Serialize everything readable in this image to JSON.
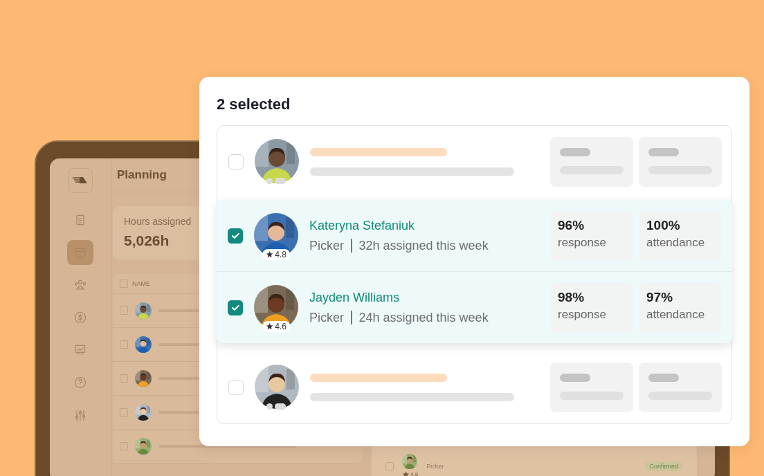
{
  "background_app": {
    "header_title": "Planning",
    "sidebar": {
      "items": [
        {
          "selected": false
        },
        {
          "selected": true
        },
        {
          "selected": false
        },
        {
          "selected": false
        },
        {
          "selected": false
        },
        {
          "selected": false
        },
        {
          "selected": false
        }
      ]
    },
    "stat_card": {
      "label": "Hours assigned",
      "value": "5,026h"
    },
    "table": {
      "column_header": "NAME",
      "header_checked": false,
      "rows": [
        {
          "kind": "skeleton",
          "checked": false
        },
        {
          "kind": "skeleton",
          "checked": false
        },
        {
          "kind": "skeleton",
          "checked": false
        },
        {
          "kind": "skeleton",
          "checked": false
        },
        {
          "kind": "skeleton",
          "checked": false
        }
      ]
    },
    "detail_row": {
      "checked": false,
      "role": "Picker",
      "rating": "4.8",
      "status": "Confirmed"
    }
  },
  "dialog": {
    "title": "2 selected",
    "rows": [
      {
        "kind": "placeholder",
        "checked": false
      },
      {
        "kind": "worker",
        "checked": true,
        "name": "Kateryna Stefaniuk",
        "role": "Picker",
        "hours": "32h assigned this week",
        "rating": "4.8",
        "stats": [
          {
            "value": "96%",
            "label": "response"
          },
          {
            "value": "100%",
            "label": "attendance"
          }
        ]
      },
      {
        "kind": "worker",
        "checked": true,
        "name": "Jayden Williams",
        "role": "Picker",
        "hours": "24h assigned this week",
        "rating": "4.6",
        "stats": [
          {
            "value": "98%",
            "label": "response"
          },
          {
            "value": "97%",
            "label": "attendance"
          }
        ]
      },
      {
        "kind": "placeholder",
        "checked": false
      }
    ]
  }
}
